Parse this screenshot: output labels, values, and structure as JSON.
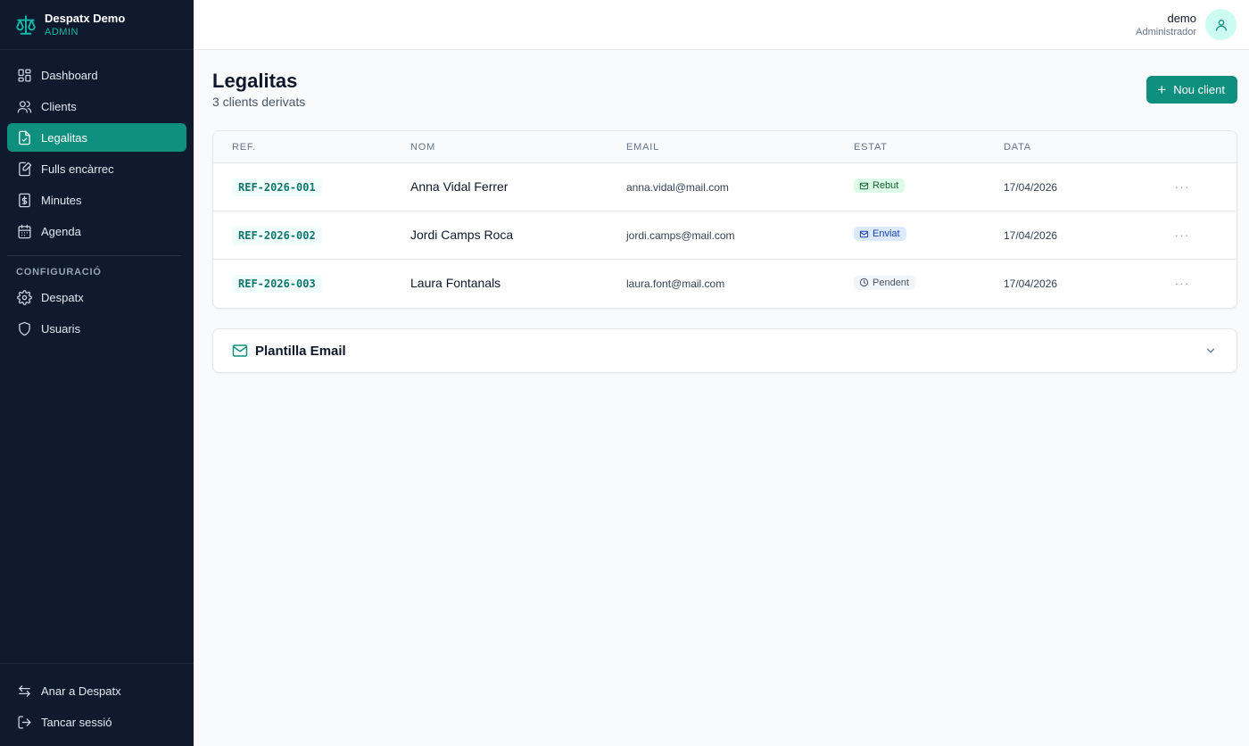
{
  "brand": {
    "name": "Despatx Demo",
    "role": "ADMIN"
  },
  "nav": [
    {
      "label": "Dashboard",
      "icon": "dashboard-icon"
    },
    {
      "label": "Clients",
      "icon": "users-icon"
    },
    {
      "label": "Legalitas",
      "icon": "document-check-icon",
      "active": true
    },
    {
      "label": "Fulls encàrrec",
      "icon": "document-edit-icon"
    },
    {
      "label": "Minutes",
      "icon": "invoice-icon"
    },
    {
      "label": "Agenda",
      "icon": "calendar-icon"
    }
  ],
  "config": {
    "section_label": "CONFIGURACIÓ",
    "items": [
      {
        "label": "Despatx",
        "icon": "gear-icon"
      },
      {
        "label": "Usuaris",
        "icon": "shield-icon"
      }
    ]
  },
  "bottom": [
    {
      "label": "Anar a Despatx",
      "icon": "swap-arrows-icon"
    },
    {
      "label": "Tancar sessió",
      "icon": "logout-icon"
    }
  ],
  "user": {
    "name": "demo",
    "role": "Administrador"
  },
  "page": {
    "title": "Legalitas",
    "subtitle": "3 clients derivats",
    "new_button": "Nou client"
  },
  "table": {
    "headers": {
      "ref": "REF.",
      "nom": "NOM",
      "email": "EMAIL",
      "estat": "ESTAT",
      "data": "DATA"
    },
    "rows": [
      {
        "ref": "REF-2026-001",
        "nom": "Anna Vidal Ferrer",
        "email": "anna.vidal@mail.com",
        "estat": "Rebut",
        "estat_color": "green",
        "data": "17/04/2026"
      },
      {
        "ref": "REF-2026-002",
        "nom": "Jordi Camps Roca",
        "email": "jordi.camps@mail.com",
        "estat": "Enviat",
        "estat_color": "blue",
        "data": "17/04/2026"
      },
      {
        "ref": "REF-2026-003",
        "nom": "Laura Fontanals",
        "email": "laura.font@mail.com",
        "estat": "Pendent",
        "estat_color": "gray",
        "data": "17/04/2026"
      }
    ]
  },
  "template": {
    "title": "Plantilla Email"
  },
  "colors": {
    "sidebar_bg": "#0f1a2e",
    "accent": "#0f8f7e",
    "accent_light": "#14b8a6"
  }
}
